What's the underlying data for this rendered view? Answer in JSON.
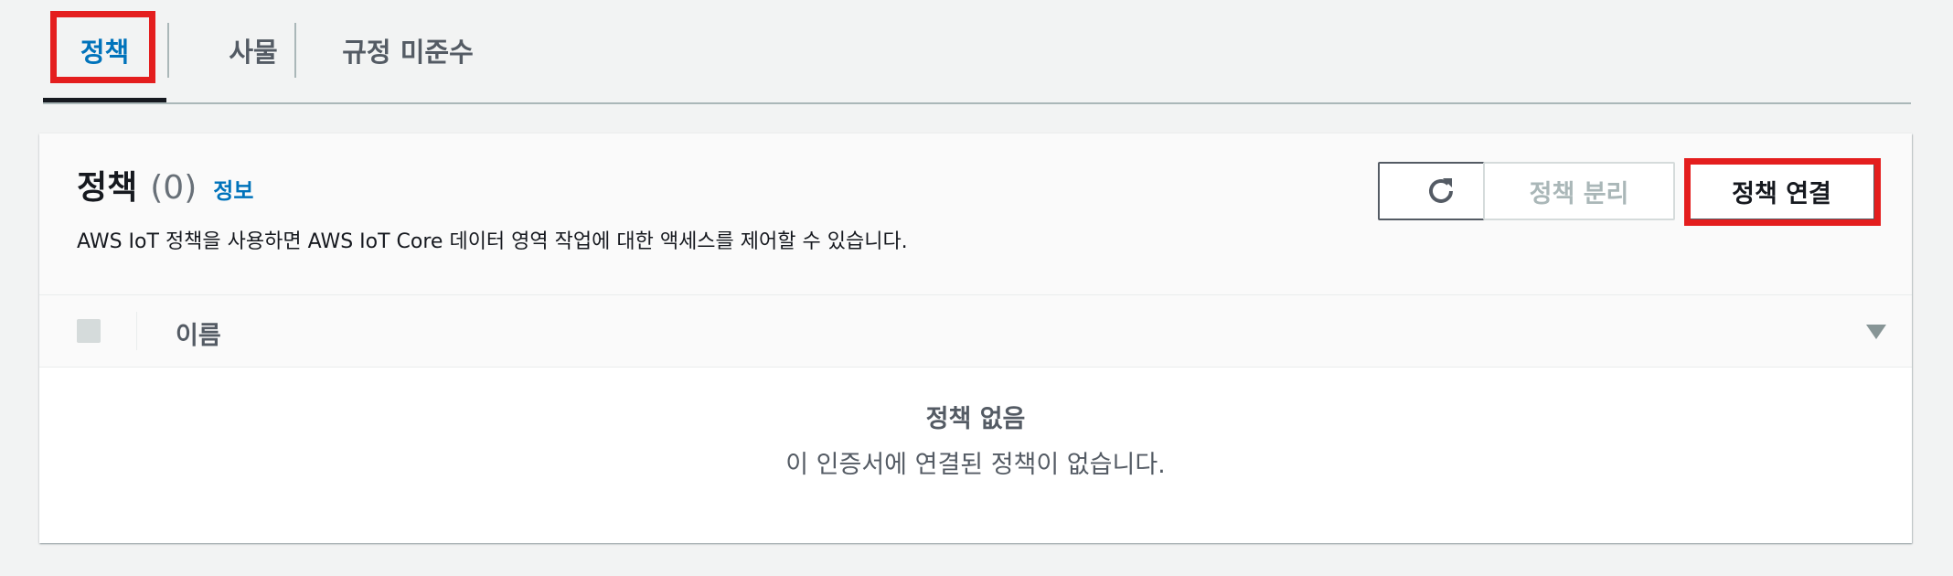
{
  "tabs": [
    {
      "label": "정책",
      "active": true
    },
    {
      "label": "사물",
      "active": false
    },
    {
      "label": "규정 미준수",
      "active": false
    }
  ],
  "panel": {
    "title": "정책",
    "count": "(0)",
    "info_link": "정보",
    "description": "AWS IoT 정책을 사용하면 AWS IoT Core 데이터 영역 작업에 대한 액세스를 제어할 수 있습니다.",
    "buttons": {
      "refresh_icon": "refresh-icon",
      "detach_label": "정책 분리",
      "attach_label": "정책 연결"
    },
    "table": {
      "column_name": "이름"
    },
    "empty": {
      "title": "정책 없음",
      "description": "이 인증서에 연결된 정책이 없습니다."
    }
  },
  "colors": {
    "accent": "#0073bb",
    "highlight": "#e41e1e",
    "text": "#16191f",
    "muted": "#545b64",
    "disabled": "#aab7b8"
  }
}
